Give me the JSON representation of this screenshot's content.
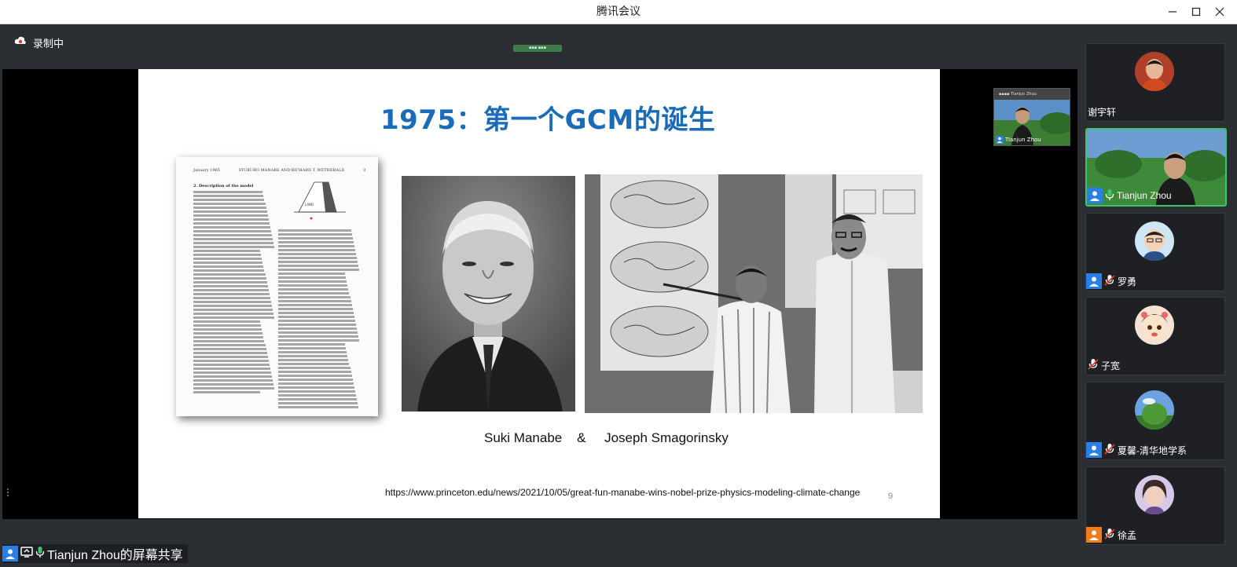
{
  "window": {
    "title": "腾讯会议",
    "minimize_icon": "minimize-icon",
    "maximize_icon": "maximize-icon",
    "close_icon": "close-icon"
  },
  "recording": {
    "label": "录制中",
    "icon": "cloud-record-icon"
  },
  "slide": {
    "title": "1975：第一个GCM的诞生",
    "paper_header_left": "January 1965",
    "paper_header_mid": "SYUKURO MANABE AND RICHARD T. WETHERALD",
    "paper_header_right": "3",
    "paper_section": "2. Description of the model",
    "names": "Suki Manabe    &     Joseph Smagorinsky",
    "url": "https://www.princeton.edu/news/2021/10/05/great-fun-manabe-wins-nobel-prize-physics-modeling-climate-change",
    "page_number": "9"
  },
  "presenter_pip": {
    "name": "Tianjun Zhou"
  },
  "screen_share_label": "Tianjun Zhou的屏幕共享",
  "participants": [
    {
      "name": "谢宇轩",
      "muted": false,
      "badge": "none"
    },
    {
      "name": "Tianjun Zhou",
      "muted": false,
      "badge": "blue",
      "active": true
    },
    {
      "name": "罗勇",
      "muted": true,
      "badge": "blue"
    },
    {
      "name": "子宽",
      "muted": true,
      "badge": "none"
    },
    {
      "name": "夏馨-清华地学系",
      "muted": true,
      "badge": "blue"
    },
    {
      "name": "徐孟",
      "muted": true,
      "badge": "orange"
    }
  ]
}
